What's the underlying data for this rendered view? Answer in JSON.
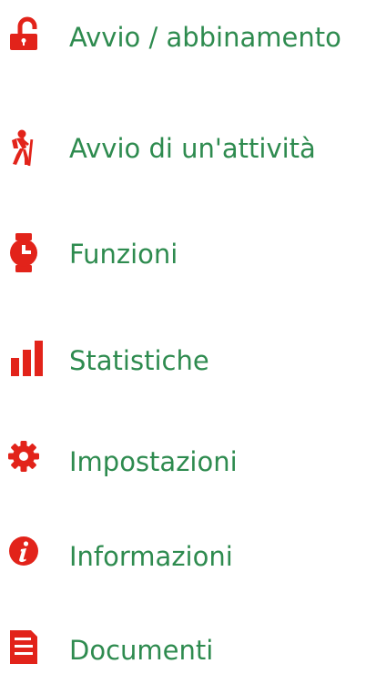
{
  "colors": {
    "icon": "#e2231a",
    "label": "#2e8b4f",
    "background": "#ffffff"
  },
  "menu": {
    "items": [
      {
        "label": "Avvio / abbinamento",
        "icon": "unlock-icon"
      },
      {
        "label": "Avvio di un'attività",
        "icon": "hiker-icon"
      },
      {
        "label": "Funzioni",
        "icon": "watch-icon"
      },
      {
        "label": "Statistiche",
        "icon": "bar-chart-icon"
      },
      {
        "label": "Impostazioni",
        "icon": "gear-icon"
      },
      {
        "label": "Informazioni",
        "icon": "info-icon"
      },
      {
        "label": "Documenti",
        "icon": "document-icon"
      }
    ]
  }
}
